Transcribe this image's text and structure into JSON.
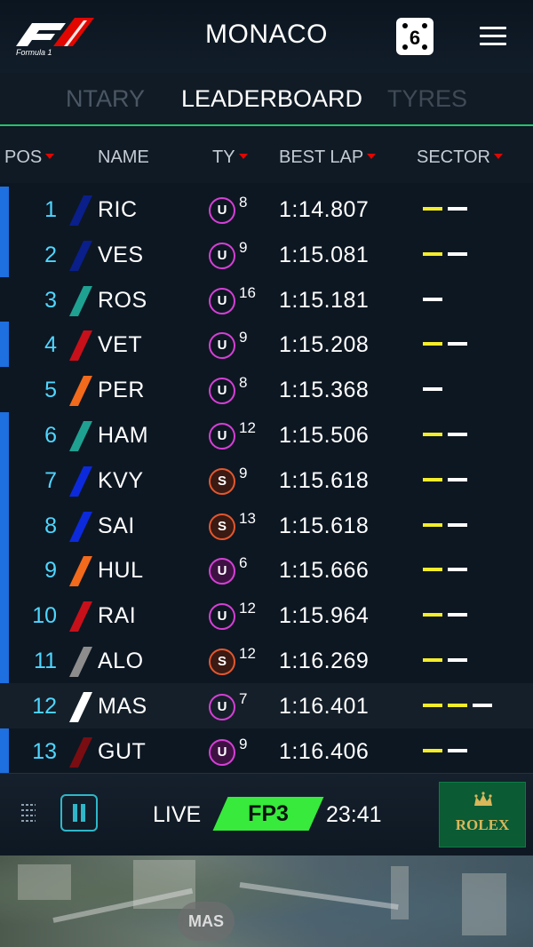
{
  "header": {
    "logo_text": "Formula 1",
    "title": "MONACO",
    "dice_value": "6",
    "menu_icon": "hamburger-menu-icon"
  },
  "tabs": [
    {
      "label": "NTARY"
    },
    {
      "label": "LEADERBOARD",
      "active": true
    },
    {
      "label": "TYRES"
    }
  ],
  "columns": {
    "pos": "POS",
    "name": "NAME",
    "tyre": "TY",
    "best_lap": "BEST LAP",
    "sector": "SECTOR"
  },
  "colors": {
    "accent_green": "#23c46b",
    "position_cyan": "#4fd6ff",
    "sort_arrow_red": "#e10600",
    "ultrasoft_purple": "#d63fd6",
    "supersoft_orange": "#e4572e",
    "sector_yellow": "#f4ed2a",
    "session_green": "#37ea3c",
    "row_marker_blue": "#1e6fe0"
  },
  "rows": [
    {
      "pos": "1",
      "name": "RIC",
      "team_color": "#0a1f8a",
      "tyre": "U",
      "tyre_type": "ultrasoft",
      "laps": "8",
      "best_lap": "1:14.807",
      "sectors": [
        "yellow",
        "white"
      ],
      "marker": true,
      "alt": false
    },
    {
      "pos": "2",
      "name": "VES",
      "team_color": "#0a1f8a",
      "tyre": "U",
      "tyre_type": "ultrasoft",
      "laps": "9",
      "best_lap": "1:15.081",
      "sectors": [
        "yellow",
        "white"
      ],
      "marker": true,
      "alt": false
    },
    {
      "pos": "3",
      "name": "ROS",
      "team_color": "#1fa191",
      "tyre": "U",
      "tyre_type": "ultrasoft",
      "laps": "16",
      "best_lap": "1:15.181",
      "sectors": [
        "white"
      ],
      "marker": false,
      "alt": false
    },
    {
      "pos": "4",
      "name": "VET",
      "team_color": "#c8101a",
      "tyre": "U",
      "tyre_type": "ultrasoft",
      "laps": "9",
      "best_lap": "1:15.208",
      "sectors": [
        "yellow",
        "white"
      ],
      "marker": true,
      "alt": false
    },
    {
      "pos": "5",
      "name": "PER",
      "team_color": "#f26a1b",
      "tyre": "U",
      "tyre_type": "ultrasoft",
      "laps": "8",
      "best_lap": "1:15.368",
      "sectors": [
        "white"
      ],
      "marker": false,
      "alt": false
    },
    {
      "pos": "6",
      "name": "HAM",
      "team_color": "#1fa191",
      "tyre": "U",
      "tyre_type": "ultrasoft",
      "laps": "12",
      "best_lap": "1:15.506",
      "sectors": [
        "yellow",
        "white"
      ],
      "marker": true,
      "alt": false
    },
    {
      "pos": "7",
      "name": "KVY",
      "team_color": "#0c2adb",
      "tyre": "S",
      "tyre_type": "supersoft",
      "laps": "9",
      "best_lap": "1:15.618",
      "sectors": [
        "yellow",
        "white"
      ],
      "marker": true,
      "alt": false
    },
    {
      "pos": "8",
      "name": "SAI",
      "team_color": "#0c2adb",
      "tyre": "S",
      "tyre_type": "supersoft",
      "laps": "13",
      "best_lap": "1:15.618",
      "sectors": [
        "yellow",
        "white"
      ],
      "marker": true,
      "alt": false
    },
    {
      "pos": "9",
      "name": "HUL",
      "team_color": "#f26a1b",
      "tyre": "U",
      "tyre_type": "ultrasoft-new",
      "laps": "6",
      "best_lap": "1:15.666",
      "sectors": [
        "yellow",
        "white"
      ],
      "marker": true,
      "alt": false
    },
    {
      "pos": "10",
      "name": "RAI",
      "team_color": "#c8101a",
      "tyre": "U",
      "tyre_type": "ultrasoft",
      "laps": "12",
      "best_lap": "1:15.964",
      "sectors": [
        "yellow",
        "white"
      ],
      "marker": true,
      "alt": false
    },
    {
      "pos": "11",
      "name": "ALO",
      "team_color": "#8d8d8d",
      "tyre": "S",
      "tyre_type": "supersoft",
      "laps": "12",
      "best_lap": "1:16.269",
      "sectors": [
        "yellow",
        "white"
      ],
      "marker": true,
      "alt": false
    },
    {
      "pos": "12",
      "name": "MAS",
      "team_color": "#ffffff",
      "tyre": "U",
      "tyre_type": "ultrasoft",
      "laps": "7",
      "best_lap": "1:16.401",
      "sectors": [
        "yellow",
        "yellow",
        "white"
      ],
      "marker": false,
      "alt": true
    },
    {
      "pos": "13",
      "name": "GUT",
      "team_color": "#7a0d12",
      "tyre": "U",
      "tyre_type": "ultrasoft-new",
      "laps": "9",
      "best_lap": "1:16.406",
      "sectors": [
        "yellow",
        "white"
      ],
      "marker": true,
      "alt": false
    }
  ],
  "footer": {
    "grip_icon": "drag-handle-icon",
    "pause_icon": "pause-icon",
    "live_label": "LIVE",
    "session": "FP3",
    "clock": "23:41",
    "sponsor": "ROLEX"
  },
  "map": {
    "marker_label": "MAS"
  }
}
